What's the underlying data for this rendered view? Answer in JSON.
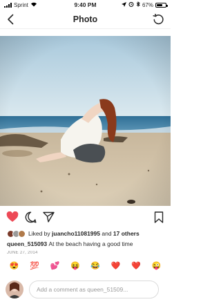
{
  "status_bar": {
    "carrier": "Sprint",
    "time": "9:40 PM",
    "battery_percent": "67%",
    "battery_level": 0.67,
    "icons": [
      "signal-icon",
      "wifi-icon",
      "location-icon",
      "alarm-icon",
      "bluetooth-icon",
      "battery-icon"
    ]
  },
  "nav": {
    "title": "Photo",
    "back_icon": "chevron-left-icon",
    "refresh_icon": "refresh-icon"
  },
  "actions": {
    "like_icon": "heart-filled-icon",
    "comment_icon": "comment-icon",
    "share_icon": "paper-plane-icon",
    "save_icon": "bookmark-icon",
    "like_color": "#ed4956"
  },
  "likes": {
    "prefix": "Liked by",
    "user": "juancho11081995",
    "and": "and",
    "others": "17 others"
  },
  "caption": {
    "username": "queen_515093",
    "text": "At the beach having a good time"
  },
  "date": "JUNE 27, 2014",
  "quick_reactions": [
    "😍",
    "💯",
    "💕",
    "😝",
    "😂",
    "❤️",
    "❤️",
    "😜"
  ],
  "comment": {
    "placeholder": "Add a comment as queen_51509..."
  }
}
